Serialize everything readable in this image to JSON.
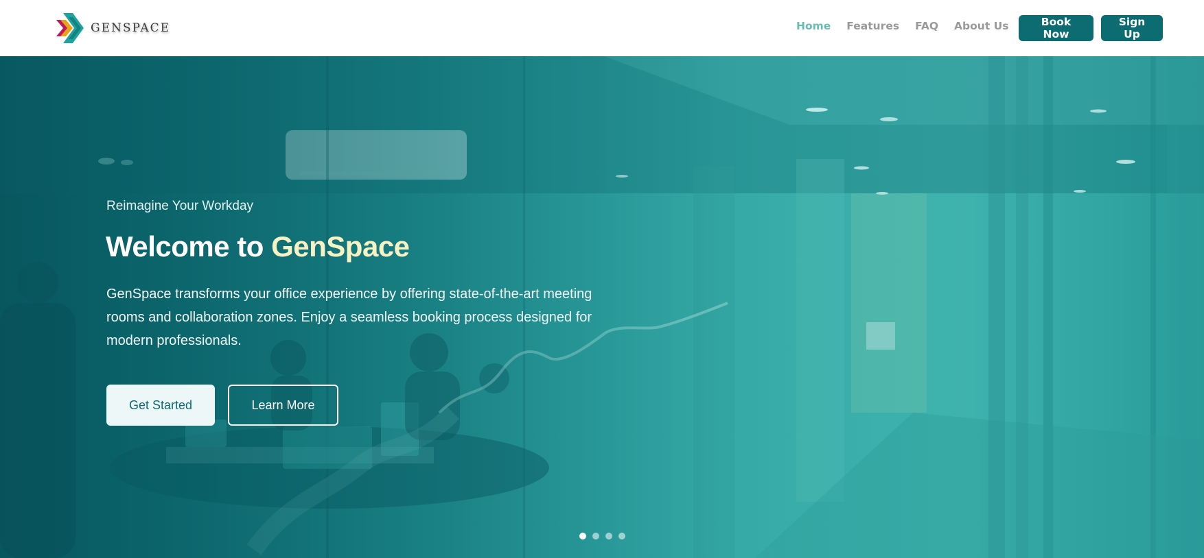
{
  "brand": {
    "name": "GENSPACE",
    "logo_icon": "chevron-logo-icon",
    "logo_colors": [
      "#c2185b",
      "#e6a417",
      "#20a39e",
      "#0d6b72"
    ]
  },
  "nav": {
    "items": [
      {
        "label": "Home",
        "active": true
      },
      {
        "label": "Features",
        "active": false
      },
      {
        "label": "FAQ",
        "active": false
      },
      {
        "label": "About Us",
        "active": false
      }
    ]
  },
  "header_buttons": {
    "book_now": "Book Now",
    "sign_up": "Sign Up"
  },
  "hero": {
    "eyebrow": "Reimagine Your Workday",
    "title_prefix": "Welcome to ",
    "title_accent": "GenSpace",
    "description": "GenSpace transforms your office experience by offering state-of-the-art meeting rooms and collaboration zones. Enjoy a seamless booking process designed for modern professionals.",
    "primary_button": "Get Started",
    "secondary_button": "Learn More",
    "carousel": {
      "slide_count": 4,
      "active_index": 0
    }
  },
  "colors": {
    "accent": "#0d6b72",
    "nav_active": "#6bbbb5",
    "title_accent": "#f7f2c4"
  }
}
